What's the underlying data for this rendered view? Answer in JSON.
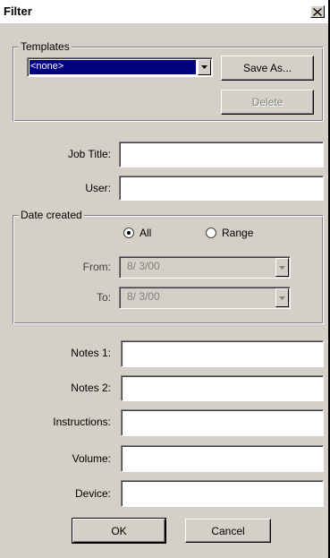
{
  "window": {
    "title": "Filter"
  },
  "templates": {
    "legend": "Templates",
    "selected": "<none>",
    "save_as_label": "Save As...",
    "delete_label": "Delete"
  },
  "fields": {
    "job_title_label": "Job Title:",
    "user_label": "User:"
  },
  "date_created": {
    "legend": "Date created",
    "radio_all": "All",
    "radio_range": "Range",
    "selected_option": "All",
    "from_label": "From:",
    "from_value": "8/ 3/00",
    "to_label": "To:",
    "to_value": "8/ 3/00"
  },
  "notes": {
    "notes1_label": "Notes 1:",
    "notes2_label": "Notes 2:",
    "instructions_label": "Instructions:",
    "volume_label": "Volume:",
    "device_label": "Device:"
  },
  "buttons": {
    "ok_label": "OK",
    "cancel_label": "Cancel"
  }
}
